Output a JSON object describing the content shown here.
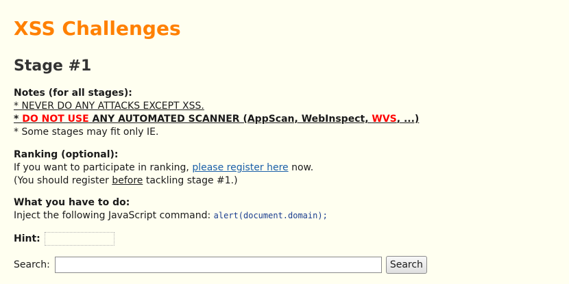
{
  "header": {
    "title": "XSS Challenges",
    "stage": "Stage #1"
  },
  "notes": {
    "heading": "Notes (for all stages):",
    "line1": "* NEVER DO ANY ATTACKS EXCEPT XSS.",
    "line2_prefix": "* ",
    "line2_red": "DO NOT USE",
    "line2_mid": " ANY AUTOMATED SCANNER (AppScan, WebInspect, ",
    "line2_wvs": "WVS",
    "line2_end": ", ...)",
    "line3": "* Some stages may fit only IE."
  },
  "ranking": {
    "heading": "Ranking (optional):",
    "line1_before": "If you want to participate in ranking, ",
    "link": "please register here",
    "line1_after": " now.",
    "line2_before": "(You should register ",
    "line2_u": "before",
    "line2_after": " tackling stage #1.)"
  },
  "todo": {
    "heading": "What you have to do:",
    "text": "Inject the following JavaScript command: ",
    "code": "alert(document.domain);"
  },
  "hint": {
    "label": "Hint:",
    "value": ""
  },
  "search": {
    "label": "Search:",
    "value": "",
    "button": "Search"
  },
  "colors": {
    "title": "#ff8000",
    "warning": "#ff0000",
    "link": "#1a5fa8",
    "background": "#fffff0"
  }
}
